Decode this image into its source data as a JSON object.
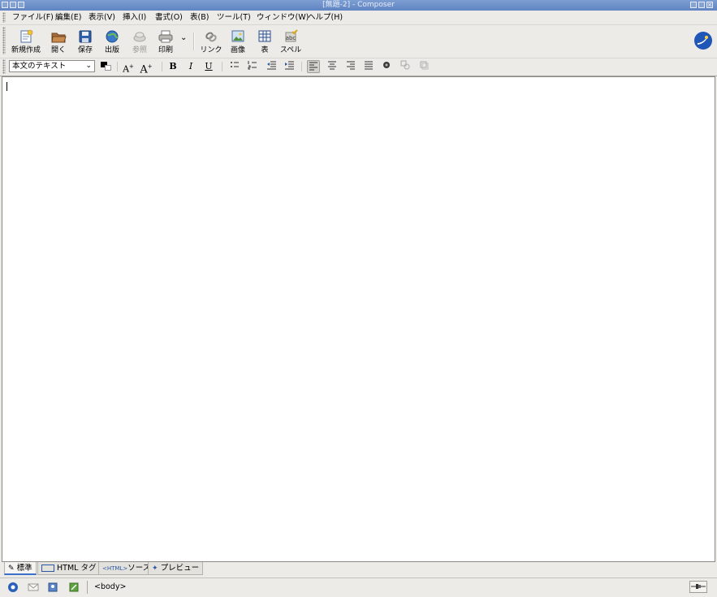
{
  "window": {
    "title": "[無題-2] - Composer"
  },
  "menubar": {
    "items": [
      "ファイル(F)",
      "編集(E)",
      "表示(V)",
      "挿入(I)",
      "書式(O)",
      "表(B)",
      "ツール(T)",
      "ウィンドウ(W)",
      "ヘルプ(H)"
    ]
  },
  "toolbar": {
    "new": "新規作成",
    "open": "開く",
    "save": "保存",
    "publish": "出版",
    "browse": "参照",
    "print": "印刷",
    "link": "リンク",
    "image": "画像",
    "table": "表",
    "spell": "スペル"
  },
  "format": {
    "paragraph_style": "本文のテキスト",
    "text_color": "#000000",
    "bold": "B",
    "italic": "I",
    "underline": "U",
    "smaller": "A",
    "larger": "A"
  },
  "tabs": [
    "標準",
    "HTML タグ",
    "ソース",
    "プレビュー"
  ],
  "tab_prefix_html": "<HTML>",
  "status": {
    "element_path": "<body>"
  },
  "colors": {
    "titlebar": "#6a8cc8",
    "background": "#ecebe8",
    "active_tab": "#3b6fc9"
  }
}
